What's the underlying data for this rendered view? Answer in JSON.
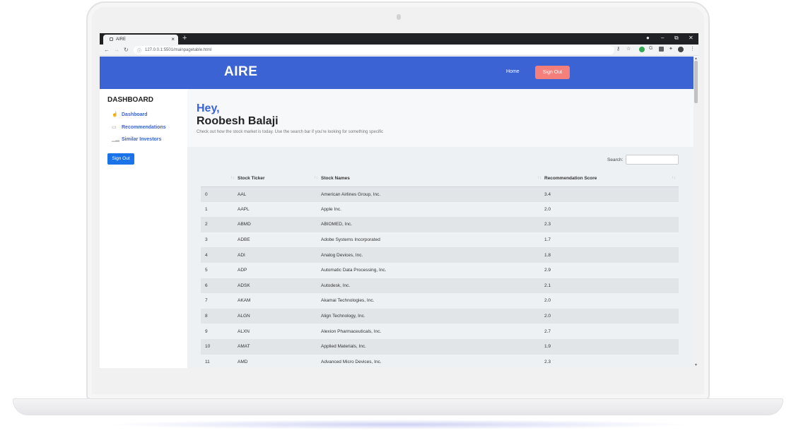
{
  "browser": {
    "tab_title": "AIRE",
    "tab_close": "×",
    "new_tab": "+",
    "url": "127.0.0.1:5501/mainpagetable.html",
    "minimize": "–",
    "restore": "⧉",
    "close": "✕"
  },
  "header": {
    "logo": "AIRE",
    "home_label": "Home",
    "signout_label": "Sign Out"
  },
  "sidebar": {
    "title": "DASHBOARD",
    "items": [
      {
        "label": "Dashboard"
      },
      {
        "label": "Recommendations"
      },
      {
        "label": "Similar Investors"
      }
    ],
    "signout_label": "Sign Out"
  },
  "welcome": {
    "greeting": "Hey,",
    "name": "Roobesh Balaji",
    "subtitle": "Check out how the stock market is today. Use the search bar if you're looking for something specific"
  },
  "table": {
    "search_label": "Search:",
    "search_value": "",
    "columns": [
      "",
      "Stock Ticker",
      "Stock Names",
      "Recommendation Score"
    ],
    "rows": [
      {
        "idx": "0",
        "ticker": "AAL",
        "name": "American Airlines Group, Inc.",
        "score": "3.4"
      },
      {
        "idx": "1",
        "ticker": "AAPL",
        "name": "Apple Inc.",
        "score": "2.0"
      },
      {
        "idx": "2",
        "ticker": "ABMD",
        "name": "ABIOMED, Inc.",
        "score": "2.3"
      },
      {
        "idx": "3",
        "ticker": "ADBE",
        "name": "Adobe Systems Incorporated",
        "score": "1.7"
      },
      {
        "idx": "4",
        "ticker": "ADI",
        "name": "Analog Devices, Inc.",
        "score": "1.8"
      },
      {
        "idx": "5",
        "ticker": "ADP",
        "name": "Automatic Data Processing, Inc.",
        "score": "2.9"
      },
      {
        "idx": "6",
        "ticker": "ADSK",
        "name": "Autodesk, Inc.",
        "score": "2.1"
      },
      {
        "idx": "7",
        "ticker": "AKAM",
        "name": "Akamai Technologies, Inc.",
        "score": "2.0"
      },
      {
        "idx": "8",
        "ticker": "ALGN",
        "name": "Align Technology, Inc.",
        "score": "2.0"
      },
      {
        "idx": "9",
        "ticker": "ALXN",
        "name": "Alexion Pharmaceuticals, Inc.",
        "score": "2.7"
      },
      {
        "idx": "10",
        "ticker": "AMAT",
        "name": "Applied Materials, Inc.",
        "score": "1.9"
      },
      {
        "idx": "11",
        "ticker": "AMD",
        "name": "Advanced Micro Devices, Inc.",
        "score": "2.3"
      }
    ]
  },
  "colors": {
    "brand": "#3b63d4",
    "signout_header": "#f57f7a",
    "signout_sidebar": "#1a73e8"
  }
}
